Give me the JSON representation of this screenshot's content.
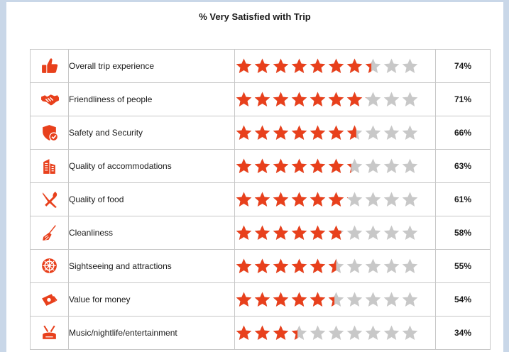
{
  "colors": {
    "accent": "#e8401c",
    "star_off": "#c8c8c8"
  },
  "chart_data": {
    "type": "table",
    "title": "% Very Satisfied with Trip",
    "stars_total": 10,
    "rows": [
      {
        "label": "Overall trip experience",
        "icon": "thumbs-up-icon",
        "value": 74,
        "display": "74%"
      },
      {
        "label": "Friendliness of people",
        "icon": "handshake-icon",
        "value": 71,
        "display": "71%"
      },
      {
        "label": "Safety and Security",
        "icon": "shield-check-icon",
        "value": 66,
        "display": "66%"
      },
      {
        "label": "Quality of accommodations",
        "icon": "building-icon",
        "value": 63,
        "display": "63%"
      },
      {
        "label": "Quality of food",
        "icon": "fork-knife-icon",
        "value": 61,
        "display": "61%"
      },
      {
        "label": "Cleanliness",
        "icon": "broom-icon",
        "value": 58,
        "display": "58%"
      },
      {
        "label": "Sightseeing and attractions",
        "icon": "ship-wheel-icon",
        "value": 55,
        "display": "55%"
      },
      {
        "label": "Value for money",
        "icon": "money-icon",
        "value": 54,
        "display": "54%"
      },
      {
        "label": "Music/nightlife/entertainment",
        "icon": "drums-icon",
        "value": 34,
        "display": "34%"
      }
    ]
  }
}
